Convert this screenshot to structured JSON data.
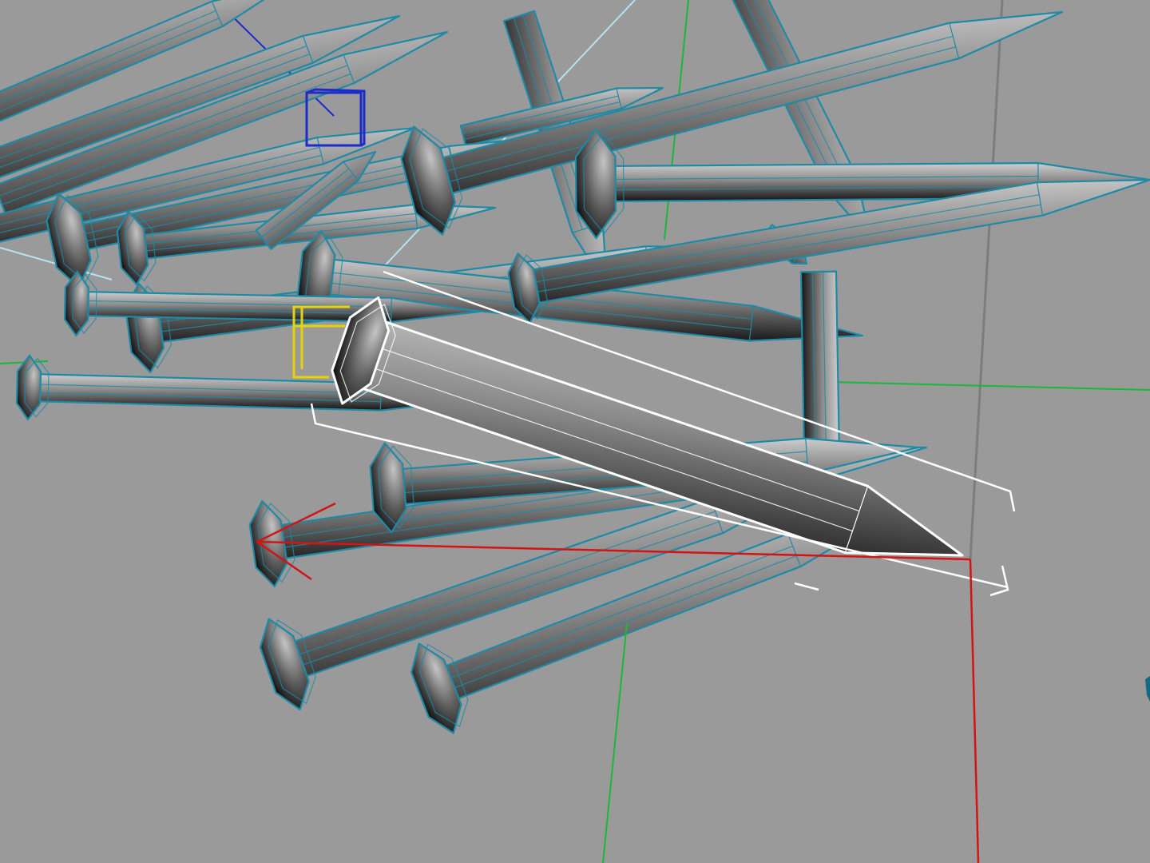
{
  "viewport": {
    "background": "#9a9a9a",
    "shaded_mode": "smooth-shade-wireframe-on-shaded"
  },
  "colors": {
    "wire": "#1f8aa6",
    "wire_dark": "#146a80",
    "selected_wire": "#ffffff",
    "axis_x": "#d31414",
    "axis_y": "#19b83a",
    "axis_z": "#1b2cc8",
    "pivot_yellow": "#e6d20a",
    "camera_line": "#b8e2f2",
    "grid_line": "#7d7d7d",
    "metal_light": "#d0d0d0",
    "metal_mid": "#8a8a8a",
    "metal_dark": "#111111"
  },
  "objects": {
    "nail_count": 22,
    "selected": "nail-selected",
    "icons": [
      "manipulator-z-handle-icon",
      "pivot-handle-icon",
      "manipulator-x-axis-icon",
      "manipulator-y-axis-icon"
    ]
  }
}
